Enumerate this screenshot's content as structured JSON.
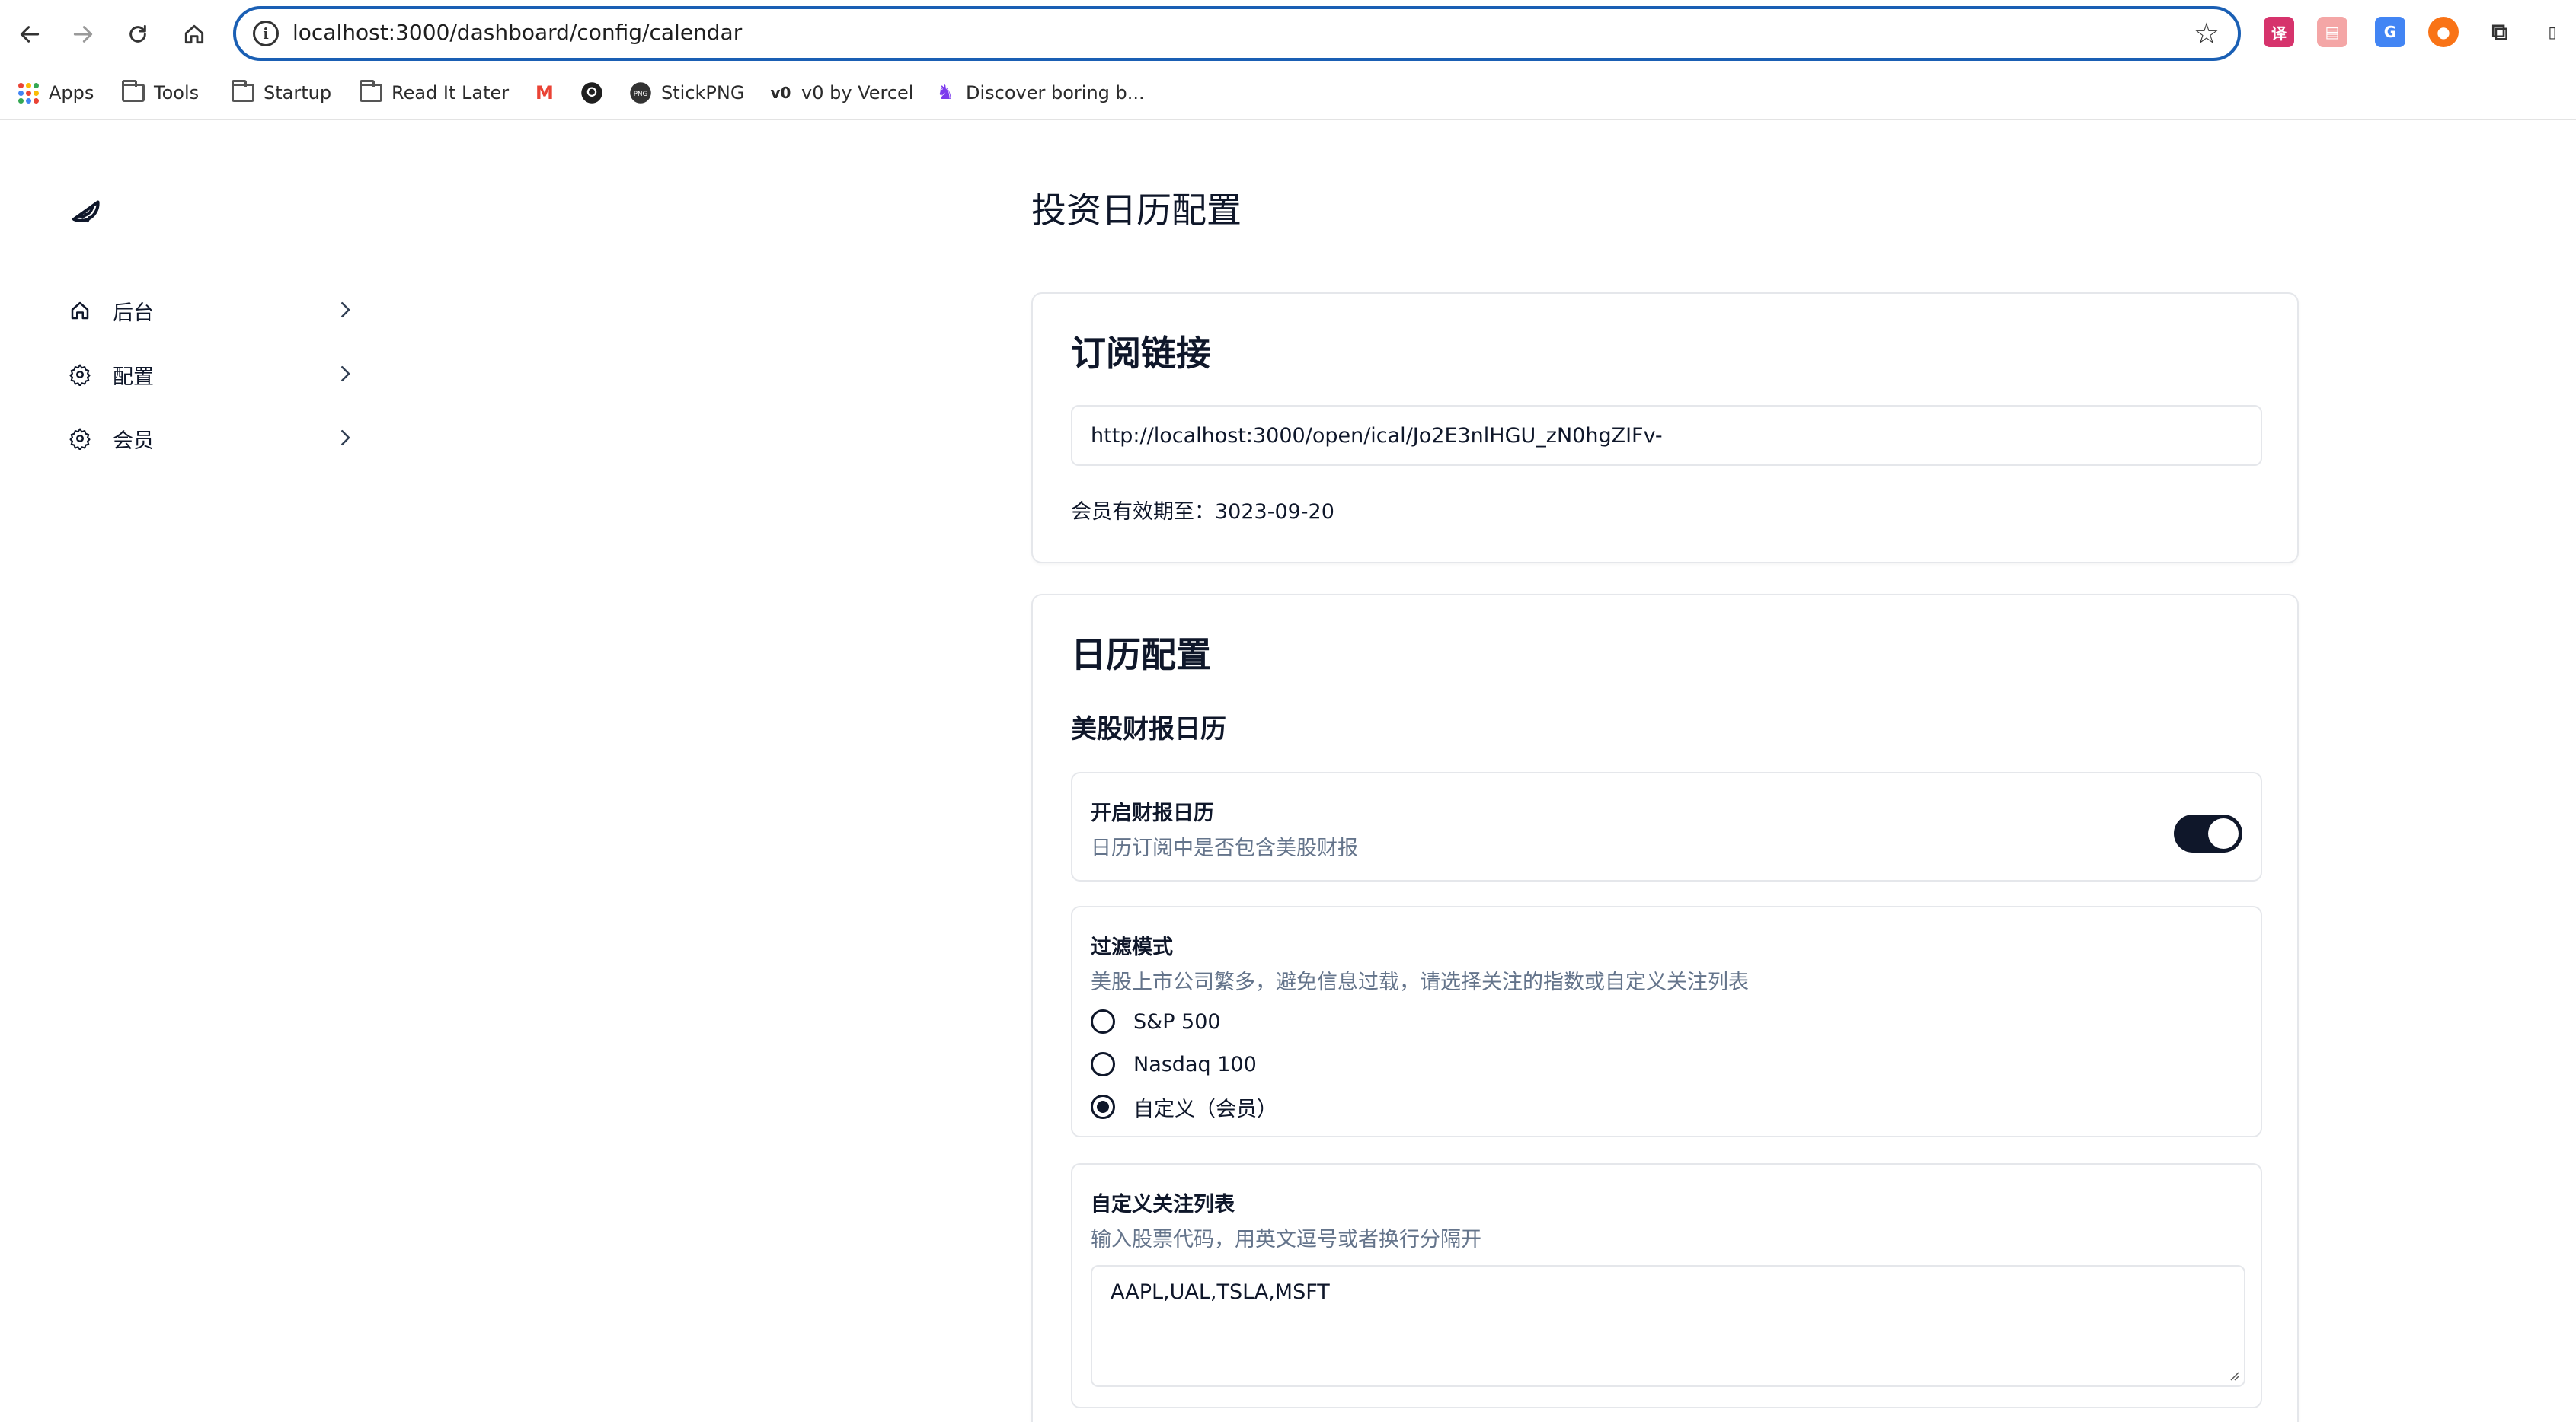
{
  "browser": {
    "url": "localhost:3000/dashboard/config/calendar",
    "bookmarks": [
      "Apps",
      "Tools",
      "Startup",
      "Read It Later",
      "StickPNG",
      "v0 by Vercel",
      "Discover boring b..."
    ]
  },
  "sidebar": {
    "items": [
      {
        "label": "后台",
        "icon": "home-icon"
      },
      {
        "label": "配置",
        "icon": "gear-icon"
      },
      {
        "label": "会员",
        "icon": "gear-icon"
      }
    ]
  },
  "page": {
    "title": "投资日历配置"
  },
  "subscription": {
    "title": "订阅链接",
    "link": "http://localhost:3000/open/ical/Jo2E3nlHGU_zN0hgZIFv-",
    "expiry": "会员有效期至：3023-09-20"
  },
  "calendar_config": {
    "title": "日历配置",
    "section_title": "美股财报日历",
    "toggle": {
      "title": "开启财报日历",
      "description": "日历订阅中是否包含美股财报",
      "enabled": true
    },
    "filter": {
      "title": "过滤模式",
      "description": "美股上市公司繁多，避免信息过载，请选择关注的指数或自定义关注列表",
      "options": [
        "S&P 500",
        "Nasdaq 100",
        "自定义（会员）"
      ],
      "selected": "自定义（会员）"
    },
    "custom_list": {
      "title": "自定义关注列表",
      "description": "输入股票代码，用英文逗号或者换行分隔开",
      "value": "AAPL,UAL,TSLA,MSFT"
    }
  },
  "colors": {
    "primary": "#0f172a",
    "muted": "#64748b",
    "border": "#e5e7eb",
    "address_focus": "#1a5fb4"
  }
}
